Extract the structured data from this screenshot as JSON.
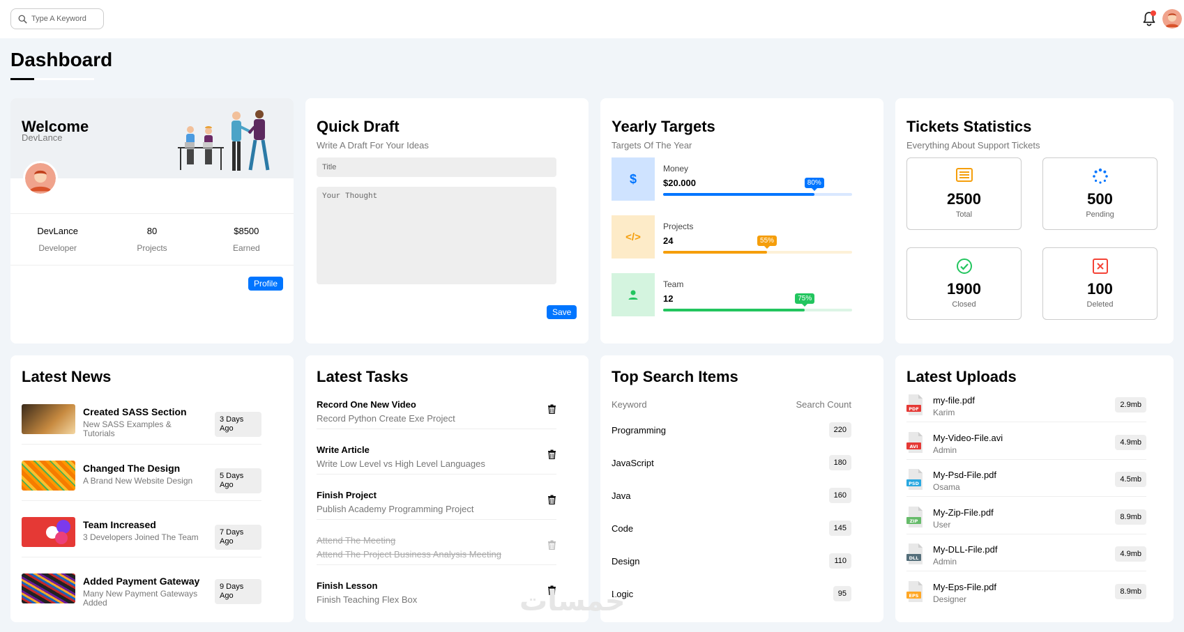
{
  "header": {
    "search_placeholder": "Type A Keyword",
    "notification_color": "#f44336"
  },
  "page": {
    "title": "Dashboard"
  },
  "welcome": {
    "title": "Welcome",
    "subtitle": "DevLance",
    "stats": [
      {
        "value": "DevLance",
        "label": "Developer"
      },
      {
        "value": "80",
        "label": "Projects"
      },
      {
        "value": "$8500",
        "label": "Earned"
      }
    ],
    "profile_button": "Profile"
  },
  "draft": {
    "title": "Quick Draft",
    "subtitle": "Write A Draft For Your Ideas",
    "title_placeholder": "Title",
    "body_placeholder": "Your Thought",
    "save_button": "Save"
  },
  "targets": {
    "title": "Yearly Targets",
    "subtitle": "Targets Of The Year",
    "items": [
      {
        "icon": "dollar-icon",
        "glyph": "$",
        "label": "Money",
        "value": "$20.000",
        "percent": 80,
        "percent_label": "80%",
        "color": "#0075ff",
        "bg": "#cfe3ff",
        "track": "#d9e8ff"
      },
      {
        "icon": "code-icon",
        "glyph": "</>",
        "label": "Projects",
        "value": "24",
        "percent": 55,
        "percent_label": "55%",
        "color": "#f59e0b",
        "bg": "#fdebc8",
        "track": "#fdf1d8"
      },
      {
        "icon": "user-icon",
        "glyph": "",
        "label": "Team",
        "value": "12",
        "percent": 75,
        "percent_label": "75%",
        "color": "#22c55e",
        "bg": "#d4f4df",
        "track": "#dcf5e5"
      }
    ]
  },
  "tickets": {
    "title": "Tickets Statistics",
    "subtitle": "Everything About Support Tickets",
    "items": [
      {
        "icon": "list-icon",
        "value": "2500",
        "label": "Total",
        "color": "#f59e0b"
      },
      {
        "icon": "spinner-icon",
        "value": "500",
        "label": "Pending",
        "color": "#0075ff"
      },
      {
        "icon": "check-circle-icon",
        "value": "1900",
        "label": "Closed",
        "color": "#22c55e"
      },
      {
        "icon": "x-square-icon",
        "value": "100",
        "label": "Deleted",
        "color": "#f44336"
      }
    ]
  },
  "news": {
    "title": "Latest News",
    "items": [
      {
        "title": "Created SASS Section",
        "desc": "New SASS Examples & Tutorials",
        "time": "3 Days Ago"
      },
      {
        "title": "Changed The Design",
        "desc": "A Brand New Website Design",
        "time": "5 Days Ago"
      },
      {
        "title": "Team Increased",
        "desc": "3 Developers Joined The Team",
        "time": "7 Days Ago"
      },
      {
        "title": "Added Payment Gateway",
        "desc": "Many New Payment Gateways Added",
        "time": "9 Days Ago"
      }
    ]
  },
  "tasks": {
    "title": "Latest Tasks",
    "items": [
      {
        "title": "Record One New Video",
        "desc": "Record Python Create Exe Project",
        "done": false
      },
      {
        "title": "Write Article",
        "desc": "Write Low Level vs High Level Languages",
        "done": false
      },
      {
        "title": "Finish Project",
        "desc": "Publish Academy Programming Project",
        "done": false
      },
      {
        "title": "Attend The Meeting",
        "desc": "Attend The Project Business Analysis Meeting",
        "done": true
      },
      {
        "title": "Finish Lesson",
        "desc": "Finish Teaching Flex Box",
        "done": false
      }
    ]
  },
  "search_items": {
    "title": "Top Search Items",
    "col_keyword": "Keyword",
    "col_count": "Search Count",
    "rows": [
      {
        "keyword": "Programming",
        "count": "220"
      },
      {
        "keyword": "JavaScript",
        "count": "180"
      },
      {
        "keyword": "Java",
        "count": "160"
      },
      {
        "keyword": "Code",
        "count": "145"
      },
      {
        "keyword": "Design",
        "count": "110"
      },
      {
        "keyword": "Logic",
        "count": "95"
      }
    ]
  },
  "uploads": {
    "title": "Latest Uploads",
    "items": [
      {
        "name": "my-file.pdf",
        "by": "Karim",
        "size": "2.9mb",
        "ext": "PDF",
        "color": "#e53935"
      },
      {
        "name": "My-Video-File.avi",
        "by": "Admin",
        "size": "4.9mb",
        "ext": "AVI",
        "color": "#e53935"
      },
      {
        "name": "My-Psd-File.pdf",
        "by": "Osama",
        "size": "4.5mb",
        "ext": "PSD",
        "color": "#29a8e0"
      },
      {
        "name": "My-Zip-File.pdf",
        "by": "User",
        "size": "8.9mb",
        "ext": "ZIP",
        "color": "#66bb6a"
      },
      {
        "name": "My-DLL-File.pdf",
        "by": "Admin",
        "size": "4.9mb",
        "ext": "DLL",
        "color": "#546e7a"
      },
      {
        "name": "My-Eps-File.pdf",
        "by": "Designer",
        "size": "8.9mb",
        "ext": "EPS",
        "color": "#ffa726"
      }
    ]
  },
  "watermark": "خمسات"
}
